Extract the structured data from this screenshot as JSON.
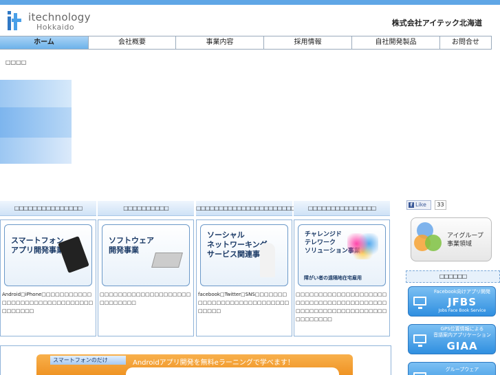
{
  "header": {
    "logo_main": "itechnology",
    "logo_sub": "Hokkaido",
    "company": "株式会社アイテック北海道"
  },
  "nav": [
    {
      "label": "ホーム",
      "active": true
    },
    {
      "label": "会社概要"
    },
    {
      "label": "事業内容"
    },
    {
      "label": "採用情報"
    },
    {
      "label": "自社開発製品"
    },
    {
      "label": "お問合せ"
    }
  ],
  "breadcrumb": "□□□□",
  "columns": [
    {
      "heading": "□□□□□□□□□□□□□□□",
      "card_title": "スマートフォン\nアプリ開発事業",
      "card_sub": "",
      "desc": "Android□iPhone□□□□□□□□□□□□□□□□□□□□□□□□□□□□□□□□□□□□□□"
    },
    {
      "heading": "□□□□□□□□□□",
      "card_title": "ソフトウェア\n開発事業",
      "card_sub": "",
      "desc": "□□□□□□□□□□□□□□□□□□□□□□□□□□□□"
    },
    {
      "heading": "□□□□□□□□□□□□□□□□□□□□□□□",
      "card_title": "ソーシャル\nネットワーキング\nサービス関連事業",
      "card_sub": "",
      "desc": "facebook□Twitter□SNS□□□□□□□□□□□□□□□□□□□□□□□□□□□□□□□□"
    },
    {
      "heading": "□□□□□□□□□□□□□□□",
      "card_title": "チャレンジド\nテレワーク\nソリューション事業",
      "card_sub": "障がい者の遠隔地在宅雇用",
      "desc": "□□□□□□□□□□□□□□□□□□□□□□□□□□□□□□□□□□□□□□□□□□□□□□□□□□□□□□□□□□□□□□□□□□□□"
    }
  ],
  "sidebar": {
    "like_label": "Like",
    "like_count": "33",
    "group_label": "アイグループ\n事業領域",
    "section_heading": "□□□□□□",
    "banners": [
      {
        "sub": "Facebook向けアプリ開発",
        "big": "JFBS",
        "under": "Jobs Face Book Service"
      },
      {
        "sub": "GPS位置情報による\n音語案内アプリケーション",
        "big": "GIAA",
        "under": ""
      },
      {
        "sub": "グループウェア",
        "big": "",
        "under": ""
      }
    ]
  },
  "promo": {
    "tab": "スマートフォンのだけ",
    "text": "Androidアプリ開発を無料eラーニングで学べます！"
  }
}
